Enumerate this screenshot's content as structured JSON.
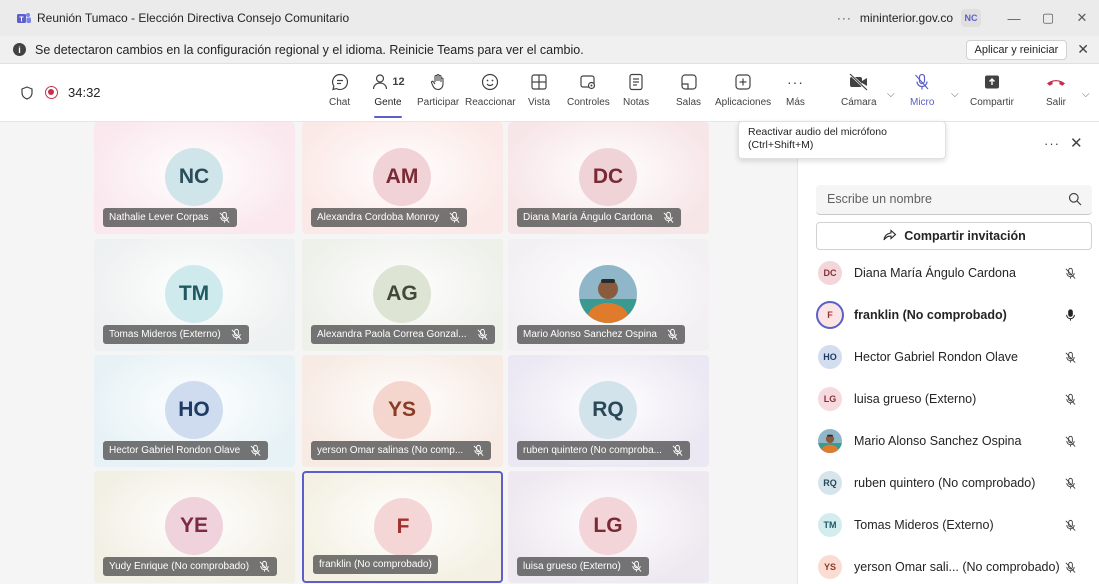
{
  "window": {
    "title": "Reunión Tumaco - Elección Directiva Consejo Comunitario",
    "domain": "mininterior.gov.co",
    "account_initials": "NC",
    "more": "···",
    "minimize": "—",
    "maximize": "▢",
    "close": "✕"
  },
  "notification": {
    "message": "Se detectaron cambios en la configuración regional y el idioma. Reinicie Teams para ver el cambio.",
    "action_label": "Aplicar y reiniciar",
    "close": "✕"
  },
  "toolbar": {
    "timer": "34:32",
    "people_count": "12",
    "items": {
      "chat": "Chat",
      "people": "Gente",
      "raise": "Participar",
      "react": "Reaccionar",
      "view": "Vista",
      "controls": "Controles",
      "notes": "Notas",
      "rooms": "Salas",
      "apps": "Aplicaciones",
      "more": "Más",
      "camera": "Cámara",
      "mic": "Micro",
      "share": "Compartir",
      "leave": "Salir"
    },
    "more_glyph": "···"
  },
  "tooltip": {
    "line1": "Reactivar audio del micrófono",
    "line2": "(Ctrl+Shift+M)"
  },
  "tiles": [
    {
      "initials": "NC",
      "name": "Nathalie Lever Corpas",
      "bg": "#fae8ee",
      "avatar_bg": "#cfe5ea",
      "avatar_fg": "#2b4d5a",
      "muted": true
    },
    {
      "initials": "AM",
      "name": "Alexandra Cordoba Monroy",
      "bg": "#fbe9e7",
      "avatar_bg": "#f1d2d6",
      "avatar_fg": "#7a2a35",
      "muted": true
    },
    {
      "initials": "DC",
      "name": "Diana María Ángulo Cardona",
      "bg": "#f7e6e8",
      "avatar_bg": "#efd3d6",
      "avatar_fg": "#7a2a35",
      "muted": true
    },
    {
      "initials": "TM",
      "name": "Tomas Mideros (Externo)",
      "bg": "#eef1f1",
      "avatar_bg": "#cfeaed",
      "avatar_fg": "#1f5a62",
      "muted": true
    },
    {
      "initials": "AG",
      "name": "Alexandra Paola Correa Gonzal...",
      "bg": "#eef0ea",
      "avatar_bg": "#dde4d4",
      "avatar_fg": "#404a36",
      "muted": true
    },
    {
      "initials": "",
      "name": "Mario Alonso Sanchez Ospina",
      "bg": "#f3f0f3",
      "avatar_bg": "#8fb6c9",
      "avatar_fg": "#ffffff",
      "muted": true,
      "photo": true
    },
    {
      "initials": "HO",
      "name": "Hector Gabriel Rondon Olave",
      "bg": "#e7f2f6",
      "avatar_bg": "#cfdcef",
      "avatar_fg": "#1e3b63",
      "muted": true
    },
    {
      "initials": "YS",
      "name": "yerson Omar salinas (No comp...",
      "bg": "#f7ebe4",
      "avatar_bg": "#f5d6cf",
      "avatar_fg": "#8a3b26",
      "muted": true
    },
    {
      "initials": "RQ",
      "name": "ruben quintero (No comproba...",
      "bg": "#ece8f3",
      "avatar_bg": "#d3e3ec",
      "avatar_fg": "#2a4858",
      "muted": true
    },
    {
      "initials": "YE",
      "name": "Yudy Enrique (No comprobado)",
      "bg": "#f2efe4",
      "avatar_bg": "#efd2dc",
      "avatar_fg": "#7a2a45",
      "muted": true
    },
    {
      "initials": "F",
      "name": "franklin (No comprobado)",
      "bg": "#f4f1e4",
      "avatar_bg": "#f5d6d6",
      "avatar_fg": "#a2302e",
      "muted": false,
      "speaking": true
    },
    {
      "initials": "LG",
      "name": "luisa grueso (Externo)",
      "bg": "#eee8f0",
      "avatar_bg": "#f3d4d8",
      "avatar_fg": "#7a2a35",
      "muted": true
    }
  ],
  "panel": {
    "more": "···",
    "close": "✕",
    "search_placeholder": "Escribe un nombre",
    "share_label": "Compartir invitación",
    "participants": [
      {
        "initials": "DC",
        "name": "Diana María Ángulo Cardona",
        "avatar_bg": "#f3d6d9",
        "avatar_fg": "#8a2f3b",
        "muted": true
      },
      {
        "initials": "F",
        "name": "franklin (No comprobado)",
        "avatar_bg": "#fbe4e4",
        "avatar_fg": "#a2302e",
        "muted": false,
        "speaking": true
      },
      {
        "initials": "HO",
        "name": "Hector Gabriel Rondon Olave",
        "avatar_bg": "#d3ddf0",
        "avatar_fg": "#1e3b63",
        "muted": true
      },
      {
        "initials": "LG",
        "name": "luisa grueso (Externo)",
        "avatar_bg": "#f6dade",
        "avatar_fg": "#8a2f3b",
        "muted": true
      },
      {
        "initials": "",
        "name": "Mario Alonso Sanchez Ospina",
        "avatar_bg": "#8fb6c9",
        "avatar_fg": "#ffffff",
        "muted": true,
        "photo": true
      },
      {
        "initials": "RQ",
        "name": "ruben quintero (No comprobado)",
        "avatar_bg": "#d6e4ec",
        "avatar_fg": "#2a4858",
        "muted": true
      },
      {
        "initials": "TM",
        "name": "Tomas Mideros (Externo)",
        "avatar_bg": "#d3ecee",
        "avatar_fg": "#1f5a62",
        "muted": true
      },
      {
        "initials": "YS",
        "name": "yerson Omar sali... (No comprobado)",
        "avatar_bg": "#fbdcd3",
        "avatar_fg": "#8a3b26",
        "muted": true
      }
    ]
  },
  "colors": {
    "accent": "#5b5fc7",
    "leave": "#c4314b",
    "record": "#c4314b"
  }
}
